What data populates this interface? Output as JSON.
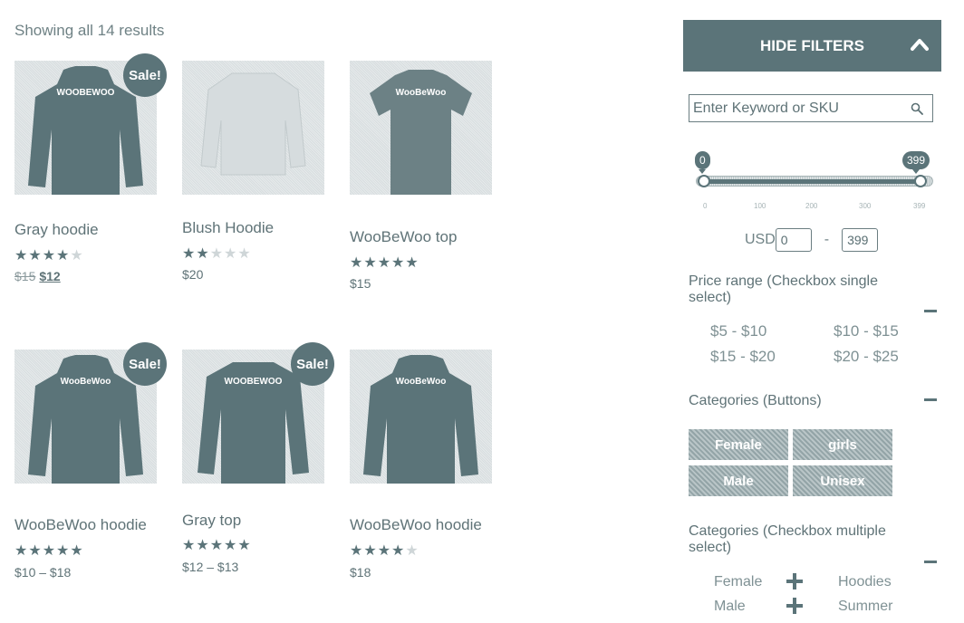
{
  "results_text": "Showing all 14 results",
  "products": [
    {
      "title": "Gray hoodie",
      "sale": true,
      "rating": 4,
      "old_price": "$15",
      "price": "$12",
      "garment": "hoodie",
      "color": "#5b7479",
      "print": "WOOBEWOO"
    },
    {
      "title": "Blush Hoodie",
      "sale": false,
      "rating": 2,
      "price": "$20",
      "garment": "sweater",
      "color": "#d6dcde",
      "print": ""
    },
    {
      "title": "WooBeWoo top",
      "sale": false,
      "rating": 5,
      "price": "$15",
      "garment": "tshirt",
      "color": "#6c8185",
      "print": "WooBeWoo"
    },
    {
      "title": "WooBeWoo hoodie",
      "sale": true,
      "rating": 5,
      "price": "$10 – $18",
      "garment": "hoodie",
      "color": "#5b7479",
      "print": "WooBeWoo"
    },
    {
      "title": "Gray top",
      "sale": true,
      "rating": 5,
      "price": "$12 – $13",
      "garment": "longsleeve",
      "color": "#5b7479",
      "print": "WOOBEWOO"
    },
    {
      "title": "WooBeWoo hoodie",
      "sale": false,
      "rating": 4,
      "price": "$18",
      "garment": "hoodie",
      "color": "#5b7479",
      "print": "WooBeWoo"
    }
  ],
  "sale_label": "Sale!",
  "filters": {
    "hide_label": "HIDE FILTERS",
    "search_placeholder": "Enter Keyword or SKU",
    "slider": {
      "min": 0,
      "max": 399,
      "min_label": "0",
      "max_label": "399",
      "ticks": [
        "0",
        "100",
        "200",
        "300",
        "399"
      ]
    },
    "currency": "USD",
    "min_value": "0",
    "max_value": "399",
    "range_dash": "-",
    "price_range_title": "Price range (Checkbox single select)",
    "price_ranges": [
      "$5 - $10",
      "$10 - $15",
      "$15 - $20",
      "$20 - $25"
    ],
    "categories_buttons_title": "Categories (Buttons)",
    "category_buttons": [
      "Female",
      "girls",
      "Male",
      "Unisex"
    ],
    "categories_checkbox_title": "Categories (Checkbox multiple select)",
    "category_checkboxes": [
      "Female",
      "Hoodies",
      "Male",
      "Summer"
    ]
  },
  "colors": {
    "accent": "#5b7479",
    "text": "#5f7377"
  }
}
